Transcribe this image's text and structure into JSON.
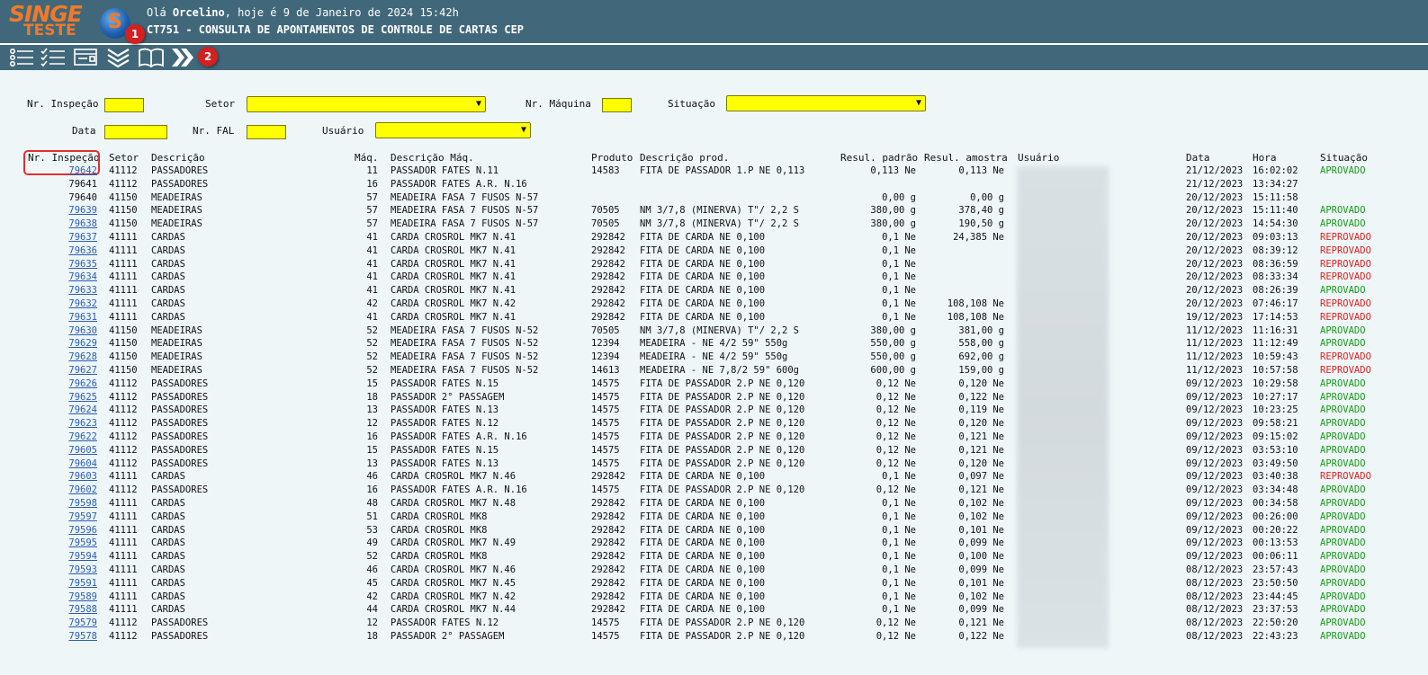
{
  "app": {
    "logo_text": "SINGE",
    "logo_sub": "TESTE",
    "logo_circle_letter": "S",
    "greeting_prefix": "Olá ",
    "user_name": "Orcelino",
    "greeting_suffix": ", hoje é 9 de Janeiro de 2024 15:42h",
    "screen_title": "CT751 - CONSULTA DE APONTAMENTOS DE CONTROLE DE CARTAS CEP",
    "colors": {
      "header": "#41687a",
      "input": "#ffff00",
      "approved": "#1a9a1a",
      "rejected": "#e02020",
      "link": "#2a5db0"
    }
  },
  "toolbar": {
    "icons": [
      "list-icon",
      "checklist-icon",
      "form-icon",
      "double-chevron-down-icon",
      "open-book-icon",
      "double-chevron-right-icon"
    ],
    "badges": [
      "1",
      "2"
    ]
  },
  "filters": {
    "nr_inspecao": "Nr. Inspeção",
    "setor": "Setor",
    "nr_maquina": "Nr. Máquina",
    "situacao": "Situação",
    "data": "Data",
    "nr_fal": "Nr. FAL",
    "usuario": "Usuário"
  },
  "table": {
    "headers": {
      "nr": "Nr. Inspeção",
      "setor": "Setor",
      "descricao": "Descrição",
      "maq": "Máq.",
      "desc_maq": "Descrição Máq.",
      "produto": "Produto",
      "desc_prod": "Descrição prod.",
      "padrao": "Resul. padrão",
      "amostra": "Resul. amostra",
      "usuario": "Usuário",
      "data": "Data",
      "hora": "Hora",
      "situacao": "Situação"
    },
    "rows": [
      {
        "nr": "79642",
        "link": true,
        "setor": "41112",
        "descricao": "PASSADORES",
        "maq": "11",
        "desc_maq": "PASSADOR FATES N.11",
        "produto": "14583",
        "desc_prod": "FITA DE PASSADOR 1.P NE 0,113",
        "padrao": "0,113 Ne",
        "amostra": "0,113 Ne",
        "data": "21/12/2023",
        "hora": "16:02:02",
        "situacao": "APROVADO"
      },
      {
        "nr": "79641",
        "link": false,
        "setor": "41112",
        "descricao": "PASSADORES",
        "maq": "16",
        "desc_maq": "PASSADOR FATES A.R. N.16",
        "produto": "",
        "desc_prod": "",
        "padrao": "",
        "amostra": "",
        "data": "21/12/2023",
        "hora": "13:34:27",
        "situacao": ""
      },
      {
        "nr": "79640",
        "link": false,
        "setor": "41150",
        "descricao": "MEADEIRAS",
        "maq": "57",
        "desc_maq": "MEADEIRA FASA 7 FUSOS N-57",
        "produto": "",
        "desc_prod": "",
        "padrao": "0,00 g",
        "amostra": "0,00 g",
        "data": "20/12/2023",
        "hora": "15:11:58",
        "situacao": ""
      },
      {
        "nr": "79639",
        "link": true,
        "setor": "41150",
        "descricao": "MEADEIRAS",
        "maq": "57",
        "desc_maq": "MEADEIRA FASA 7 FUSOS N-57",
        "produto": "70505",
        "desc_prod": "NM 3/7,8 (MINERVA) T\"/ 2,2 S",
        "padrao": "380,00 g",
        "amostra": "378,40 g",
        "data": "20/12/2023",
        "hora": "15:11:40",
        "situacao": "APROVADO"
      },
      {
        "nr": "79638",
        "link": true,
        "setor": "41150",
        "descricao": "MEADEIRAS",
        "maq": "57",
        "desc_maq": "MEADEIRA FASA 7 FUSOS N-57",
        "produto": "70505",
        "desc_prod": "NM 3/7,8 (MINERVA) T\"/ 2,2 S",
        "padrao": "380,00 g",
        "amostra": "190,50 g",
        "data": "20/12/2023",
        "hora": "14:54:30",
        "situacao": "APROVADO"
      },
      {
        "nr": "79637",
        "link": true,
        "setor": "41111",
        "descricao": "CARDAS",
        "maq": "41",
        "desc_maq": "CARDA CROSROL MK7 N.41",
        "produto": "292842",
        "desc_prod": "FITA DE CARDA NE 0,100",
        "padrao": "0,1 Ne",
        "amostra": "24,385 Ne",
        "data": "20/12/2023",
        "hora": "09:03:13",
        "situacao": "REPROVADO"
      },
      {
        "nr": "79636",
        "link": true,
        "setor": "41111",
        "descricao": "CARDAS",
        "maq": "41",
        "desc_maq": "CARDA CROSROL MK7 N.41",
        "produto": "292842",
        "desc_prod": "FITA DE CARDA NE 0,100",
        "padrao": "0,1 Ne",
        "amostra": "",
        "data": "20/12/2023",
        "hora": "08:39:12",
        "situacao": "REPROVADO"
      },
      {
        "nr": "79635",
        "link": true,
        "setor": "41111",
        "descricao": "CARDAS",
        "maq": "41",
        "desc_maq": "CARDA CROSROL MK7 N.41",
        "produto": "292842",
        "desc_prod": "FITA DE CARDA NE 0,100",
        "padrao": "0,1 Ne",
        "amostra": "",
        "data": "20/12/2023",
        "hora": "08:36:59",
        "situacao": "REPROVADO"
      },
      {
        "nr": "79634",
        "link": true,
        "setor": "41111",
        "descricao": "CARDAS",
        "maq": "41",
        "desc_maq": "CARDA CROSROL MK7 N.41",
        "produto": "292842",
        "desc_prod": "FITA DE CARDA NE 0,100",
        "padrao": "0,1 Ne",
        "amostra": "",
        "data": "20/12/2023",
        "hora": "08:33:34",
        "situacao": "REPROVADO"
      },
      {
        "nr": "79633",
        "link": true,
        "setor": "41111",
        "descricao": "CARDAS",
        "maq": "41",
        "desc_maq": "CARDA CROSROL MK7 N.41",
        "produto": "292842",
        "desc_prod": "FITA DE CARDA NE 0,100",
        "padrao": "0,1 Ne",
        "amostra": "",
        "data": "20/12/2023",
        "hora": "08:26:39",
        "situacao": "APROVADO"
      },
      {
        "nr": "79632",
        "link": true,
        "setor": "41111",
        "descricao": "CARDAS",
        "maq": "42",
        "desc_maq": "CARDA CROSROL MK7 N.42",
        "produto": "292842",
        "desc_prod": "FITA DE CARDA NE 0,100",
        "padrao": "0,1 Ne",
        "amostra": "108,108 Ne",
        "data": "20/12/2023",
        "hora": "07:46:17",
        "situacao": "REPROVADO"
      },
      {
        "nr": "79631",
        "link": true,
        "setor": "41111",
        "descricao": "CARDAS",
        "maq": "41",
        "desc_maq": "CARDA CROSROL MK7 N.41",
        "produto": "292842",
        "desc_prod": "FITA DE CARDA NE 0,100",
        "padrao": "0,1 Ne",
        "amostra": "108,108 Ne",
        "data": "19/12/2023",
        "hora": "17:14:53",
        "situacao": "REPROVADO"
      },
      {
        "nr": "79630",
        "link": true,
        "setor": "41150",
        "descricao": "MEADEIRAS",
        "maq": "52",
        "desc_maq": "MEADEIRA FASA 7 FUSOS N-52",
        "produto": "70505",
        "desc_prod": "NM 3/7,8 (MINERVA) T\"/ 2,2 S",
        "padrao": "380,00 g",
        "amostra": "381,00 g",
        "data": "11/12/2023",
        "hora": "11:16:31",
        "situacao": "APROVADO"
      },
      {
        "nr": "79629",
        "link": true,
        "setor": "41150",
        "descricao": "MEADEIRAS",
        "maq": "52",
        "desc_maq": "MEADEIRA FASA 7 FUSOS N-52",
        "produto": "12394",
        "desc_prod": "MEADEIRA - NE 4/2 59\" 550g",
        "padrao": "550,00 g",
        "amostra": "558,00 g",
        "data": "11/12/2023",
        "hora": "11:12:49",
        "situacao": "APROVADO"
      },
      {
        "nr": "79628",
        "link": true,
        "setor": "41150",
        "descricao": "MEADEIRAS",
        "maq": "52",
        "desc_maq": "MEADEIRA FASA 7 FUSOS N-52",
        "produto": "12394",
        "desc_prod": "MEADEIRA - NE 4/2 59\" 550g",
        "padrao": "550,00 g",
        "amostra": "692,00 g",
        "data": "11/12/2023",
        "hora": "10:59:43",
        "situacao": "REPROVADO"
      },
      {
        "nr": "79627",
        "link": true,
        "setor": "41150",
        "descricao": "MEADEIRAS",
        "maq": "52",
        "desc_maq": "MEADEIRA FASA 7 FUSOS N-52",
        "produto": "14613",
        "desc_prod": "MEADEIRA - NE 7,8/2 59\" 600g",
        "padrao": "600,00 g",
        "amostra": "159,00 g",
        "data": "11/12/2023",
        "hora": "10:57:58",
        "situacao": "REPROVADO"
      },
      {
        "nr": "79626",
        "link": true,
        "setor": "41112",
        "descricao": "PASSADORES",
        "maq": "15",
        "desc_maq": "PASSADOR FATES N.15",
        "produto": "14575",
        "desc_prod": "FITA DE PASSADOR 2.P NE 0,120",
        "padrao": "0,12 Ne",
        "amostra": "0,120 Ne",
        "data": "09/12/2023",
        "hora": "10:29:58",
        "situacao": "APROVADO"
      },
      {
        "nr": "79625",
        "link": true,
        "setor": "41112",
        "descricao": "PASSADORES",
        "maq": "18",
        "desc_maq": "PASSADOR 2° PASSAGEM",
        "produto": "14575",
        "desc_prod": "FITA DE PASSADOR 2.P NE 0,120",
        "padrao": "0,12 Ne",
        "amostra": "0,122 Ne",
        "data": "09/12/2023",
        "hora": "10:27:17",
        "situacao": "APROVADO"
      },
      {
        "nr": "79624",
        "link": true,
        "setor": "41112",
        "descricao": "PASSADORES",
        "maq": "13",
        "desc_maq": "PASSADOR FATES N.13",
        "produto": "14575",
        "desc_prod": "FITA DE PASSADOR 2.P NE 0,120",
        "padrao": "0,12 Ne",
        "amostra": "0,119 Ne",
        "data": "09/12/2023",
        "hora": "10:23:25",
        "situacao": "APROVADO"
      },
      {
        "nr": "79623",
        "link": true,
        "setor": "41112",
        "descricao": "PASSADORES",
        "maq": "12",
        "desc_maq": "PASSADOR FATES N.12",
        "produto": "14575",
        "desc_prod": "FITA DE PASSADOR 2.P NE 0,120",
        "padrao": "0,12 Ne",
        "amostra": "0,120 Ne",
        "data": "09/12/2023",
        "hora": "09:58:21",
        "situacao": "APROVADO"
      },
      {
        "nr": "79622",
        "link": true,
        "setor": "41112",
        "descricao": "PASSADORES",
        "maq": "16",
        "desc_maq": "PASSADOR FATES A.R. N.16",
        "produto": "14575",
        "desc_prod": "FITA DE PASSADOR 2.P NE 0,120",
        "padrao": "0,12 Ne",
        "amostra": "0,121 Ne",
        "data": "09/12/2023",
        "hora": "09:15:02",
        "situacao": "APROVADO"
      },
      {
        "nr": "79605",
        "link": true,
        "setor": "41112",
        "descricao": "PASSADORES",
        "maq": "15",
        "desc_maq": "PASSADOR FATES N.15",
        "produto": "14575",
        "desc_prod": "FITA DE PASSADOR 2.P NE 0,120",
        "padrao": "0,12 Ne",
        "amostra": "0,121 Ne",
        "data": "09/12/2023",
        "hora": "03:53:10",
        "situacao": "APROVADO"
      },
      {
        "nr": "79604",
        "link": true,
        "setor": "41112",
        "descricao": "PASSADORES",
        "maq": "13",
        "desc_maq": "PASSADOR FATES N.13",
        "produto": "14575",
        "desc_prod": "FITA DE PASSADOR 2.P NE 0,120",
        "padrao": "0,12 Ne",
        "amostra": "0,120 Ne",
        "data": "09/12/2023",
        "hora": "03:49:50",
        "situacao": "APROVADO"
      },
      {
        "nr": "79603",
        "link": true,
        "setor": "41111",
        "descricao": "CARDAS",
        "maq": "46",
        "desc_maq": "CARDA CROSROL MK7 N.46",
        "produto": "292842",
        "desc_prod": "FITA DE CARDA NE 0,100",
        "padrao": "0,1 Ne",
        "amostra": "0,097 Ne",
        "data": "09/12/2023",
        "hora": "03:40:38",
        "situacao": "REPROVADO"
      },
      {
        "nr": "79602",
        "link": true,
        "setor": "41112",
        "descricao": "PASSADORES",
        "maq": "16",
        "desc_maq": "PASSADOR FATES A.R. N.16",
        "produto": "14575",
        "desc_prod": "FITA DE PASSADOR 2.P NE 0,120",
        "padrao": "0,12 Ne",
        "amostra": "0,121 Ne",
        "data": "09/12/2023",
        "hora": "03:34:48",
        "situacao": "APROVADO"
      },
      {
        "nr": "79598",
        "link": true,
        "setor": "41111",
        "descricao": "CARDAS",
        "maq": "48",
        "desc_maq": "CARDA CROSROL MK7 N.48",
        "produto": "292842",
        "desc_prod": "FITA DE CARDA NE 0,100",
        "padrao": "0,1 Ne",
        "amostra": "0,102 Ne",
        "data": "09/12/2023",
        "hora": "00:34:58",
        "situacao": "APROVADO"
      },
      {
        "nr": "79597",
        "link": true,
        "setor": "41111",
        "descricao": "CARDAS",
        "maq": "51",
        "desc_maq": "CARDA CROSROL MK8",
        "produto": "292842",
        "desc_prod": "FITA DE CARDA NE 0,100",
        "padrao": "0,1 Ne",
        "amostra": "0,102 Ne",
        "data": "09/12/2023",
        "hora": "00:26:00",
        "situacao": "APROVADO"
      },
      {
        "nr": "79596",
        "link": true,
        "setor": "41111",
        "descricao": "CARDAS",
        "maq": "53",
        "desc_maq": "CARDA CROSROL MK8",
        "produto": "292842",
        "desc_prod": "FITA DE CARDA NE 0,100",
        "padrao": "0,1 Ne",
        "amostra": "0,101 Ne",
        "data": "09/12/2023",
        "hora": "00:20:22",
        "situacao": "APROVADO"
      },
      {
        "nr": "79595",
        "link": true,
        "setor": "41111",
        "descricao": "CARDAS",
        "maq": "49",
        "desc_maq": "CARDA CROSROL MK7 N.49",
        "produto": "292842",
        "desc_prod": "FITA DE CARDA NE 0,100",
        "padrao": "0,1 Ne",
        "amostra": "0,099 Ne",
        "data": "09/12/2023",
        "hora": "00:13:53",
        "situacao": "APROVADO"
      },
      {
        "nr": "79594",
        "link": true,
        "setor": "41111",
        "descricao": "CARDAS",
        "maq": "52",
        "desc_maq": "CARDA CROSROL MK8",
        "produto": "292842",
        "desc_prod": "FITA DE CARDA NE 0,100",
        "padrao": "0,1 Ne",
        "amostra": "0,100 Ne",
        "data": "09/12/2023",
        "hora": "00:06:11",
        "situacao": "APROVADO"
      },
      {
        "nr": "79593",
        "link": true,
        "setor": "41111",
        "descricao": "CARDAS",
        "maq": "46",
        "desc_maq": "CARDA CROSROL MK7 N.46",
        "produto": "292842",
        "desc_prod": "FITA DE CARDA NE 0,100",
        "padrao": "0,1 Ne",
        "amostra": "0,099 Ne",
        "data": "08/12/2023",
        "hora": "23:57:43",
        "situacao": "APROVADO"
      },
      {
        "nr": "79591",
        "link": true,
        "setor": "41111",
        "descricao": "CARDAS",
        "maq": "45",
        "desc_maq": "CARDA CROSROL MK7 N.45",
        "produto": "292842",
        "desc_prod": "FITA DE CARDA NE 0,100",
        "padrao": "0,1 Ne",
        "amostra": "0,101 Ne",
        "data": "08/12/2023",
        "hora": "23:50:50",
        "situacao": "APROVADO"
      },
      {
        "nr": "79589",
        "link": true,
        "setor": "41111",
        "descricao": "CARDAS",
        "maq": "42",
        "desc_maq": "CARDA CROSROL MK7 N.42",
        "produto": "292842",
        "desc_prod": "FITA DE CARDA NE 0,100",
        "padrao": "0,1 Ne",
        "amostra": "0,102 Ne",
        "data": "08/12/2023",
        "hora": "23:44:45",
        "situacao": "APROVADO"
      },
      {
        "nr": "79588",
        "link": true,
        "setor": "41111",
        "descricao": "CARDAS",
        "maq": "44",
        "desc_maq": "CARDA CROSROL MK7 N.44",
        "produto": "292842",
        "desc_prod": "FITA DE CARDA NE 0,100",
        "padrao": "0,1 Ne",
        "amostra": "0,099 Ne",
        "data": "08/12/2023",
        "hora": "23:37:53",
        "situacao": "APROVADO"
      },
      {
        "nr": "79579",
        "link": true,
        "setor": "41112",
        "descricao": "PASSADORES",
        "maq": "12",
        "desc_maq": "PASSADOR FATES N.12",
        "produto": "14575",
        "desc_prod": "FITA DE PASSADOR 2.P NE 0,120",
        "padrao": "0,12 Ne",
        "amostra": "0,121 Ne",
        "data": "08/12/2023",
        "hora": "22:50:20",
        "situacao": "APROVADO"
      },
      {
        "nr": "79578",
        "link": true,
        "setor": "41112",
        "descricao": "PASSADORES",
        "maq": "18",
        "desc_maq": "PASSADOR 2° PASSAGEM",
        "produto": "14575",
        "desc_prod": "FITA DE PASSADOR 2.P NE 0,120",
        "padrao": "0,12 Ne",
        "amostra": "0,122 Ne",
        "data": "08/12/2023",
        "hora": "22:43:23",
        "situacao": "APROVADO"
      }
    ]
  }
}
